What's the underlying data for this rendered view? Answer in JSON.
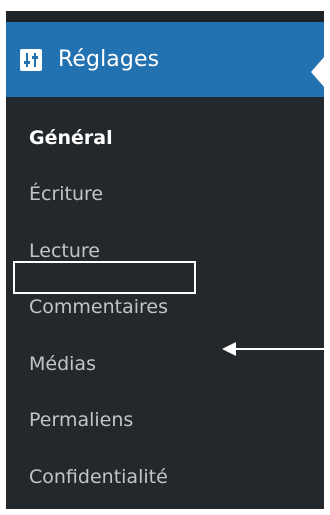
{
  "menu": {
    "header": {
      "title": "Réglages",
      "icon": "settings-sliders-icon"
    },
    "items": [
      {
        "label": "Général",
        "active": true
      },
      {
        "label": "Écriture",
        "active": false
      },
      {
        "label": "Lecture",
        "active": false
      },
      {
        "label": "Commentaires",
        "active": false
      },
      {
        "label": "Médias",
        "active": false,
        "highlighted": true
      },
      {
        "label": "Permaliens",
        "active": false
      },
      {
        "label": "Confidentialité",
        "active": false
      }
    ]
  },
  "annotation": {
    "icon": "arrow-left-icon"
  },
  "colors": {
    "sidebar_bg": "#23282d",
    "header_bg": "#2271b1",
    "text_muted": "#c3c4c7",
    "text_active": "#ffffff",
    "annotation": "#ffffff"
  }
}
